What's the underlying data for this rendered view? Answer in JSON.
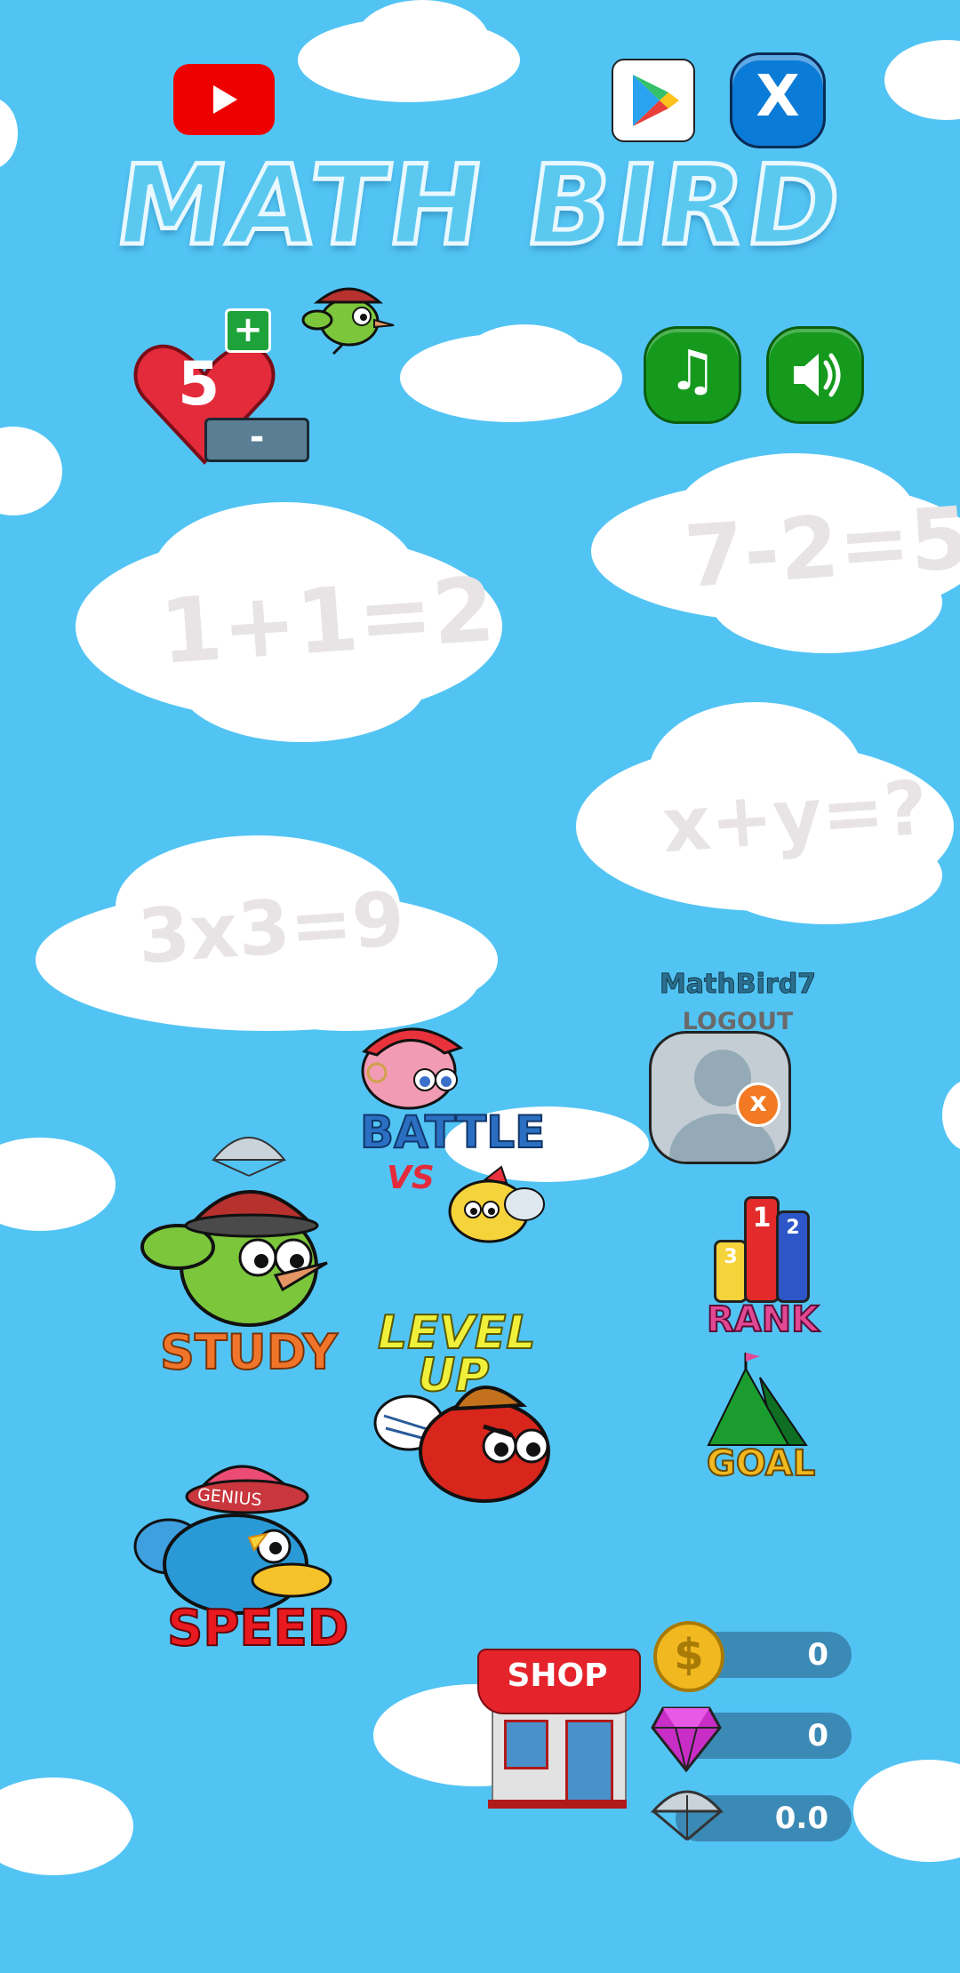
{
  "app": {
    "title": "MATH BIRD"
  },
  "header_icons": {
    "youtube": "youtube-icon",
    "play_store": "google-play-icon",
    "close": "x-icon",
    "close_label": "X"
  },
  "lives": {
    "count": "5",
    "plus": "+",
    "minus": "-"
  },
  "audio": {
    "music_icon": "music-note-icon",
    "sound_icon": "speaker-icon"
  },
  "clouds": {
    "eq1": "1+1=2",
    "eq2": "7-2=5",
    "eq3": "x+y=?",
    "eq4": "3x3=9"
  },
  "user": {
    "name": "MathBird7",
    "logout": "LOGOUT",
    "remove": "x"
  },
  "menu": {
    "battle": "BATTLE",
    "vs": "VS",
    "study": "STUDY",
    "level_up_1": "LEVEL",
    "level_up_2": "UP",
    "speed": "SPEED",
    "genius_hat": "GENIUS",
    "rank": "RANK",
    "goal": "GOAL",
    "podium_1": "1",
    "podium_2": "2",
    "podium_3": "3"
  },
  "shop": {
    "label": "SHOP"
  },
  "currency": {
    "coins": "0",
    "coin_symbol": "$",
    "gems": "0",
    "parachutes": "0.0"
  },
  "colors": {
    "sky": "#52c4f4",
    "green_button": "#159a1d",
    "youtube_red": "#ee0000",
    "pill": "#3b8ab6"
  }
}
